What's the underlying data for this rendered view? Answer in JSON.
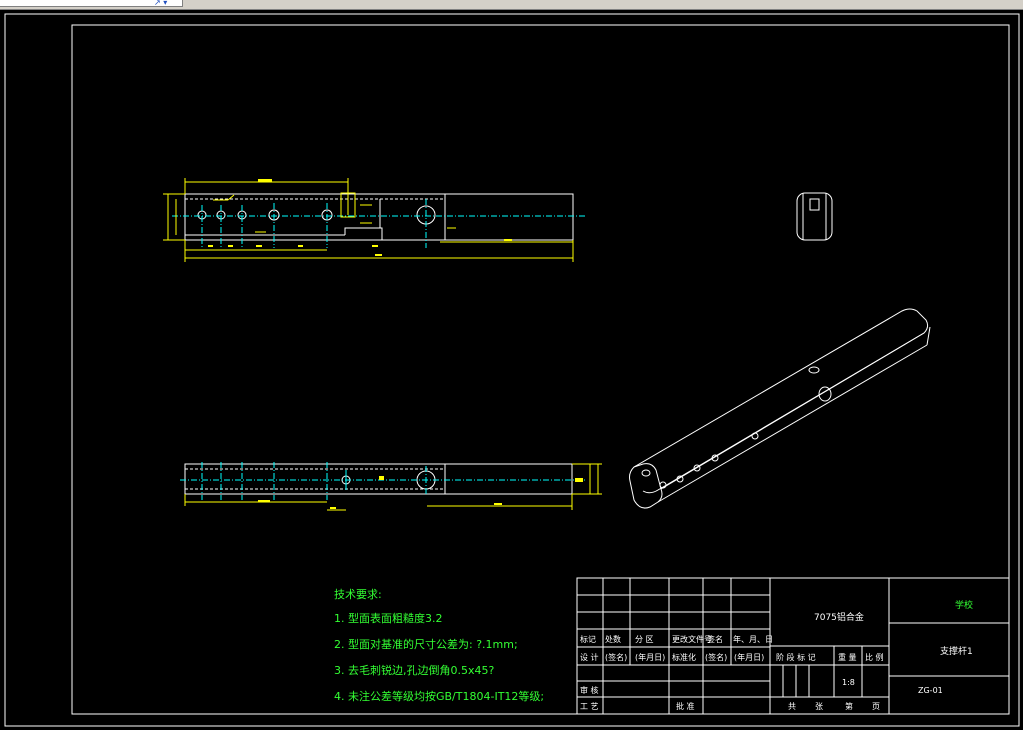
{
  "tech_requirements": {
    "title": "技术要求:",
    "items": [
      "1. 型面表面粗糙度3.2",
      "2. 型面对基准的尺寸公差为: ?.1mm;",
      "3. 去毛刺锐边,孔边倒角0.5x45?",
      "4. 未注公差等级均按GB/T1804-IT12等级;"
    ]
  },
  "title_block": {
    "material": "7075铝合金",
    "school": "学校",
    "part_name": "支撑杆1",
    "drawing_no": "ZG-01",
    "scale": "1:8",
    "row_labels": {
      "mark": "标记",
      "count": "处数",
      "zone": "分 区",
      "change_doc": "更改文件号",
      "signature": "签名",
      "date": "年、月、日",
      "design": "设 计",
      "sign1": "(签名)",
      "date1": "(年月日)",
      "standardize": "标准化",
      "sign2": "(签名)",
      "date2": "(年月日)",
      "review": "审 核",
      "process": "工 艺",
      "approve": "批 准"
    },
    "stage_labels": {
      "stage_mark": "阶 段 标 记",
      "weight": "重 量",
      "ratio": "比 例",
      "total": "共",
      "sheets": "张",
      "page_no": "第",
      "page": "页"
    }
  },
  "colors": {
    "background": "#000000",
    "frame": "#ffffff",
    "geometry": "#ffffff",
    "dimension": "#ffff00",
    "centerline": "#00ffff",
    "notes": "#33ff33"
  }
}
